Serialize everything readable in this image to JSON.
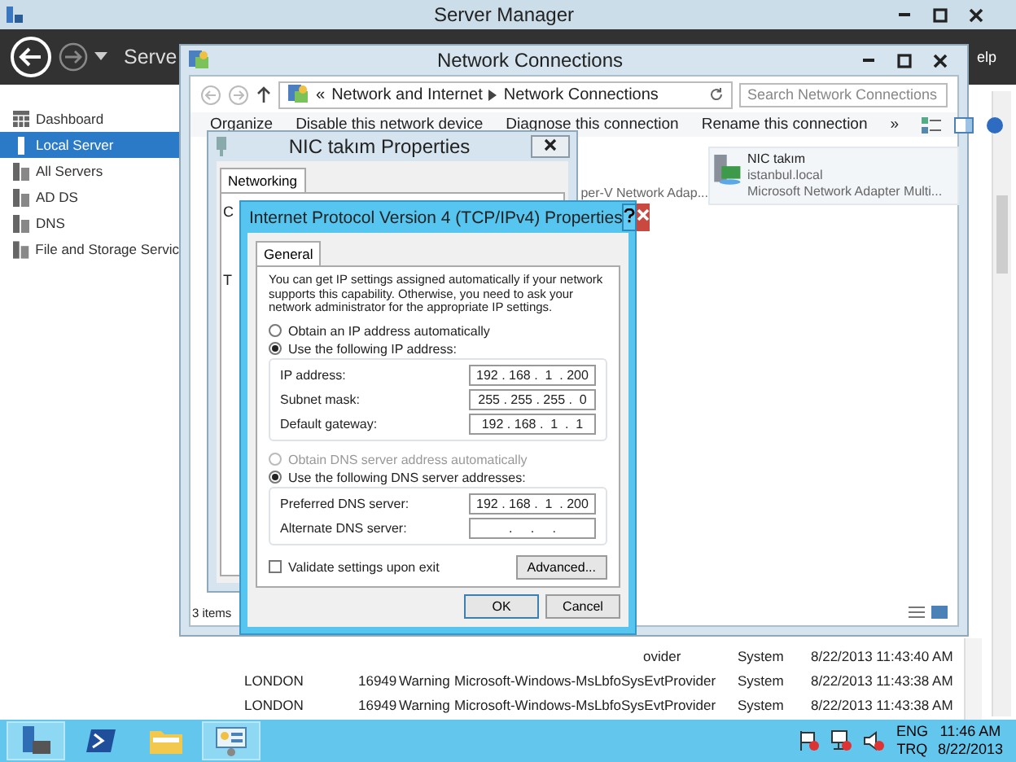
{
  "server_manager": {
    "title": "Server Manager",
    "header_title": "Serve",
    "header_help": "elp",
    "sidebar": [
      {
        "label": "Dashboard",
        "selected": false
      },
      {
        "label": "Local Server",
        "selected": true
      },
      {
        "label": "All Servers",
        "selected": false
      },
      {
        "label": "AD DS",
        "selected": false
      },
      {
        "label": "DNS",
        "selected": false
      },
      {
        "label": "File and Storage Servic",
        "selected": false
      }
    ],
    "events": [
      {
        "kind": "partial",
        "source": "ovider",
        "log": "System",
        "date": "8/22/2013 11:43:40 AM"
      },
      {
        "kind": "full",
        "server": "LONDON",
        "id": "16949",
        "severity": "Warning",
        "source": "Microsoft-Windows-MsLbfoSysEvtProvider",
        "log": "System",
        "date": "8/22/2013 11:43:38 AM"
      },
      {
        "kind": "full",
        "server": "LONDON",
        "id": "16949",
        "severity": "Warning",
        "source": "Microsoft-Windows-MsLbfoSysEvtProvider",
        "log": "System",
        "date": "8/22/2013 11:43:38 AM"
      }
    ]
  },
  "network_connections": {
    "title": "Network Connections",
    "breadcrumb_prefix": "«",
    "breadcrumb": [
      "Network and Internet",
      "Network Connections"
    ],
    "search": {
      "placeholder": "Search Network Connections"
    },
    "toolbar": [
      "Organize",
      "Disable this network device",
      "Diagnose this connection",
      "Rename this connection",
      "»"
    ],
    "adapters": [
      {
        "kind": "partial",
        "lines": [
          "per-V Network Adap..."
        ]
      },
      {
        "kind": "full",
        "name": "NIC takım",
        "lines": [
          "istanbul.local",
          "Microsoft Network Adapter Multi..."
        ]
      }
    ],
    "status": "3 items"
  },
  "nic_properties": {
    "title": "NIC takım Properties",
    "tab": "Networking",
    "fragments": [
      "C",
      "T"
    ]
  },
  "ipv4": {
    "title": "Internet Protocol Version 4 (TCP/IPv4) Properties",
    "tab": "General",
    "intro": "You can get IP settings assigned automatically if your network supports this capability. Otherwise, you need to ask your network administrator for the appropriate IP settings.",
    "ip_options": [
      {
        "label": "Obtain an IP address automatically",
        "selected": false,
        "disabled": false
      },
      {
        "label": "Use the following IP address:",
        "selected": true,
        "disabled": false
      }
    ],
    "ip_fields": [
      {
        "label": "IP address:",
        "value": "192 . 168 .  1  . 200"
      },
      {
        "label": "Subnet mask:",
        "value": "255 . 255 . 255 .  0"
      },
      {
        "label": "Default gateway:",
        "value": "192 . 168 .  1  .  1"
      }
    ],
    "dns_options": [
      {
        "label": "Obtain DNS server address automatically",
        "selected": false,
        "disabled": true
      },
      {
        "label": "Use the following DNS server addresses:",
        "selected": true,
        "disabled": false
      }
    ],
    "dns_fields": [
      {
        "label": "Preferred DNS server:",
        "value": "192 . 168 .  1  . 200"
      },
      {
        "label": "Alternate DNS server:",
        "value": ".     .     ."
      }
    ],
    "validate": {
      "label": "Validate settings upon exit",
      "checked": false
    },
    "advanced": "Advanced...",
    "buttons": [
      "OK",
      "Cancel"
    ]
  },
  "taskbar": {
    "apps": [
      {
        "highlighted": true
      },
      {
        "highlighted": false
      },
      {
        "highlighted": false
      },
      {
        "highlighted": true
      }
    ],
    "language": [
      "ENG",
      "TRQ"
    ],
    "time": "11:46 AM",
    "date": "8/22/2013"
  }
}
